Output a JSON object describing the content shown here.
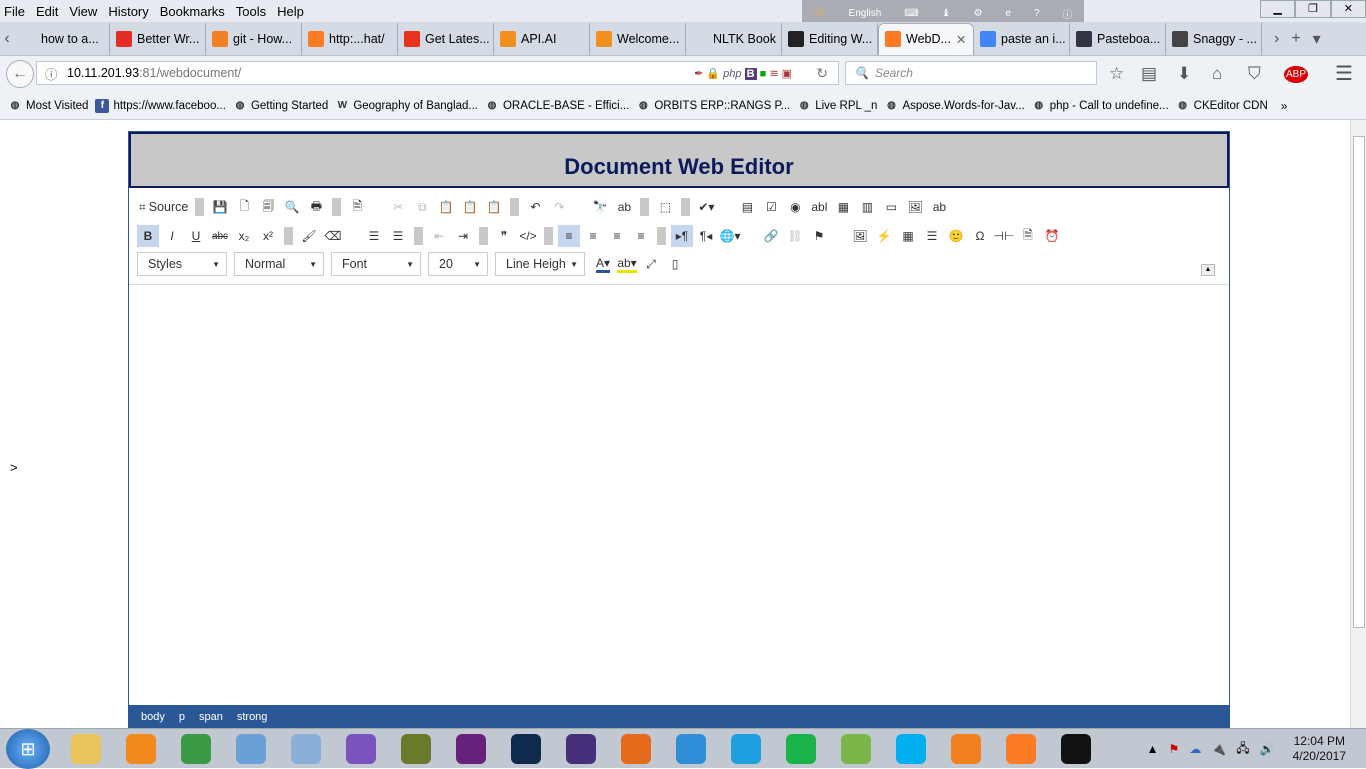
{
  "menubar": [
    "File",
    "Edit",
    "View",
    "History",
    "Bookmarks",
    "Tools",
    "Help"
  ],
  "langbar": {
    "label": "English"
  },
  "tabs": [
    {
      "label": "how to a...",
      "icon": "none-icon",
      "color": "#d5dbe4"
    },
    {
      "label": "Better Wr...",
      "icon": "youtube-icon",
      "color": "#e52d27"
    },
    {
      "label": "git - How...",
      "icon": "stackoverflow-icon",
      "color": "#f48024"
    },
    {
      "label": "http:...hat/",
      "icon": "xampp-icon",
      "color": "#fb7a24"
    },
    {
      "label": "Get Lates...",
      "icon": "bug-icon",
      "color": "#e8321b"
    },
    {
      "label": "API.AI",
      "icon": "apiai-icon",
      "color": "#f18f1f"
    },
    {
      "label": "Welcome...",
      "icon": "apiai-icon",
      "color": "#f18f1f"
    },
    {
      "label": "NLTK Book",
      "icon": "none-icon",
      "color": "#d5dbe4"
    },
    {
      "label": "Editing W...",
      "icon": "github-icon",
      "color": "#222222"
    },
    {
      "label": "WebD...",
      "icon": "xampp-icon",
      "color": "#fb7a24",
      "active": true
    },
    {
      "label": "paste an i...",
      "icon": "google-icon",
      "color": "#4285f4"
    },
    {
      "label": "Pasteboa...",
      "icon": "window-icon",
      "color": "#334"
    },
    {
      "label": "Snaggy - ...",
      "icon": "sg-icon",
      "color": "#444"
    }
  ],
  "address": {
    "host": "10.11.201.93",
    "rest": ":81/webdocument/"
  },
  "search": {
    "placeholder": "Search"
  },
  "bookmarks": [
    {
      "label": "Most Visited",
      "icon": "most-visited-icon"
    },
    {
      "label": "https://www.faceboo...",
      "icon": "facebook-icon"
    },
    {
      "label": "Getting Started",
      "icon": "firefox-icon"
    },
    {
      "label": "Geography of Banglad...",
      "icon": "wikipedia-icon"
    },
    {
      "label": "ORACLE-BASE - Effici...",
      "icon": "oracle-icon"
    },
    {
      "label": "ORBITS ERP::RANGS P...",
      "icon": "globe-icon"
    },
    {
      "label": "Live RPL _n",
      "icon": "globe-icon"
    },
    {
      "label": "Aspose.Words-for-Jav...",
      "icon": "github-icon"
    },
    {
      "label": "php - Call to undefine...",
      "icon": "stackoverflow-icon"
    },
    {
      "label": "CKEditor CDN",
      "icon": "globe-icon"
    }
  ],
  "page": {
    "gt": ">",
    "title": "Document Web Editor"
  },
  "toolbar": {
    "row1": [
      {
        "name": "source-button",
        "glyph": "⌗",
        "label": "Source"
      },
      {
        "sep": true
      },
      {
        "name": "save-icon",
        "glyph": "💾",
        "dis": true
      },
      {
        "name": "new-page-icon",
        "glyph": "🗋"
      },
      {
        "name": "templates-icon",
        "glyph": "🗐"
      },
      {
        "name": "preview-icon",
        "glyph": "🔍"
      },
      {
        "name": "print-icon",
        "glyph": "🖶"
      },
      {
        "sep": true
      },
      {
        "name": "document-icon",
        "glyph": "🗎"
      },
      {
        "sep": true,
        "hidden": true
      },
      {
        "name": "cut-icon",
        "glyph": "✂",
        "dis": true
      },
      {
        "name": "copy-icon",
        "glyph": "⧉",
        "dis": true
      },
      {
        "name": "paste-icon",
        "glyph": "📋"
      },
      {
        "name": "paste-text-icon",
        "glyph": "📋"
      },
      {
        "name": "paste-word-icon",
        "glyph": "📋"
      },
      {
        "sep": true
      },
      {
        "name": "undo-icon",
        "glyph": "↶"
      },
      {
        "name": "redo-icon",
        "glyph": "↷",
        "dis": true
      },
      {
        "sep": true,
        "hidden": true
      },
      {
        "name": "find-icon",
        "glyph": "🔭"
      },
      {
        "name": "replace-icon",
        "glyph": "ab"
      },
      {
        "sep": true
      },
      {
        "name": "select-all-icon",
        "glyph": "⬚"
      },
      {
        "sep": true
      },
      {
        "name": "spellcheck-icon",
        "glyph": "✔▾"
      },
      {
        "sep": true,
        "hidden": true
      },
      {
        "name": "form-icon",
        "glyph": "▤"
      },
      {
        "name": "checkbox-icon",
        "glyph": "☑"
      },
      {
        "name": "radio-icon",
        "glyph": "◉"
      },
      {
        "name": "textfield-icon",
        "glyph": "abl"
      },
      {
        "name": "textarea-icon",
        "glyph": "▦"
      },
      {
        "name": "select-icon",
        "glyph": "▥"
      },
      {
        "name": "button-icon",
        "glyph": "▭"
      },
      {
        "name": "image-button-icon",
        "glyph": "🖼"
      },
      {
        "name": "hidden-field-icon",
        "glyph": "ab"
      }
    ],
    "row2": [
      {
        "name": "bold-icon",
        "glyph": "B",
        "on": true
      },
      {
        "name": "italic-icon",
        "glyph": "I"
      },
      {
        "name": "underline-icon",
        "glyph": "U"
      },
      {
        "name": "strike-icon",
        "glyph": "abc"
      },
      {
        "name": "subscript-icon",
        "glyph": "x₂"
      },
      {
        "name": "superscript-icon",
        "glyph": "x²"
      },
      {
        "sep": true
      },
      {
        "name": "copy-format-icon",
        "glyph": "🖌"
      },
      {
        "name": "remove-format-icon",
        "glyph": "⌫"
      },
      {
        "sep": true,
        "hidden": true
      },
      {
        "name": "numbered-list-icon",
        "glyph": "☰"
      },
      {
        "name": "bulleted-list-icon",
        "glyph": "☰"
      },
      {
        "sep": true
      },
      {
        "name": "outdent-icon",
        "glyph": "⇤",
        "dis": true
      },
      {
        "name": "indent-icon",
        "glyph": "⇥"
      },
      {
        "sep": true
      },
      {
        "name": "blockquote-icon",
        "glyph": "❞"
      },
      {
        "name": "div-icon",
        "glyph": "</>"
      },
      {
        "sep": true
      },
      {
        "name": "align-left-icon",
        "glyph": "≡",
        "on": true
      },
      {
        "name": "align-center-icon",
        "glyph": "≡"
      },
      {
        "name": "align-right-icon",
        "glyph": "≡"
      },
      {
        "name": "justify-icon",
        "glyph": "≡"
      },
      {
        "sep": true
      },
      {
        "name": "ltr-icon",
        "glyph": "▸¶",
        "on": true
      },
      {
        "name": "rtl-icon",
        "glyph": "¶◂"
      },
      {
        "name": "language-icon",
        "glyph": "🌐▾"
      },
      {
        "sep": true,
        "hidden": true
      },
      {
        "name": "link-icon",
        "glyph": "🔗"
      },
      {
        "name": "unlink-icon",
        "glyph": "⛓",
        "dis": true
      },
      {
        "name": "anchor-icon",
        "glyph": "⚑"
      },
      {
        "sep": true,
        "hidden": true
      },
      {
        "name": "image-icon",
        "glyph": "🖼"
      },
      {
        "name": "flash-icon",
        "glyph": "⚡"
      },
      {
        "name": "table-icon",
        "glyph": "▦"
      },
      {
        "name": "horizontal-line-icon",
        "glyph": "☰"
      },
      {
        "name": "smiley-icon",
        "glyph": "🙂"
      },
      {
        "name": "special-char-icon",
        "glyph": "Ω"
      },
      {
        "name": "page-break-icon",
        "glyph": "⊣⊢"
      },
      {
        "name": "iframe-icon",
        "glyph": "🗎"
      },
      {
        "name": "clock-icon",
        "glyph": "⏰"
      }
    ],
    "combos": [
      {
        "name": "styles-dropdown",
        "label": "Styles",
        "w": 90
      },
      {
        "name": "format-dropdown",
        "label": "Normal",
        "w": 90
      },
      {
        "name": "font-dropdown",
        "label": "Font",
        "w": 90
      },
      {
        "name": "font-size-dropdown",
        "label": "20",
        "w": 60
      },
      {
        "name": "line-height-dropdown",
        "label": "Line Heigh",
        "w": 90
      }
    ],
    "row3extra": [
      {
        "name": "text-color-icon",
        "glyph": "A▾",
        "color": "#2b5797"
      },
      {
        "name": "bg-color-icon",
        "glyph": "ab▾",
        "color": "#e6e600"
      },
      {
        "name": "maximize-icon",
        "glyph": "⤢"
      },
      {
        "name": "show-blocks-icon",
        "glyph": "▯"
      }
    ]
  },
  "statusbar": [
    "body",
    "p",
    "span",
    "strong"
  ],
  "taskbar": [
    {
      "name": "explorer",
      "color": "#e8c45a"
    },
    {
      "name": "media-player",
      "color": "#f08a1c"
    },
    {
      "name": "chrome",
      "color": "#3c9a46"
    },
    {
      "name": "safari",
      "color": "#6aa0d8"
    },
    {
      "name": "virtualbox",
      "color": "#8ab0d8"
    },
    {
      "name": "viber",
      "color": "#7b53c1"
    },
    {
      "name": "frog-app",
      "color": "#6b7a2a"
    },
    {
      "name": "visual-studio",
      "color": "#68217a"
    },
    {
      "name": "vs-code",
      "color": "#0e2a4d"
    },
    {
      "name": "eclipse",
      "color": "#47307a"
    },
    {
      "name": "firefox",
      "color": "#e66a1c"
    },
    {
      "name": "hotspot-shield",
      "color": "#2f8ed8"
    },
    {
      "name": "internet-explorer",
      "color": "#1ea0e0"
    },
    {
      "name": "oval-app",
      "color": "#19b34a"
    },
    {
      "name": "notepad-plus",
      "color": "#7ab648"
    },
    {
      "name": "skype",
      "color": "#00aff0"
    },
    {
      "name": "foxit-pdf",
      "color": "#f08020"
    },
    {
      "name": "xampp",
      "color": "#fb7a24"
    },
    {
      "name": "cmd",
      "color": "#111111"
    }
  ],
  "clock": {
    "time": "12:04 PM",
    "date": "4/20/2017"
  }
}
